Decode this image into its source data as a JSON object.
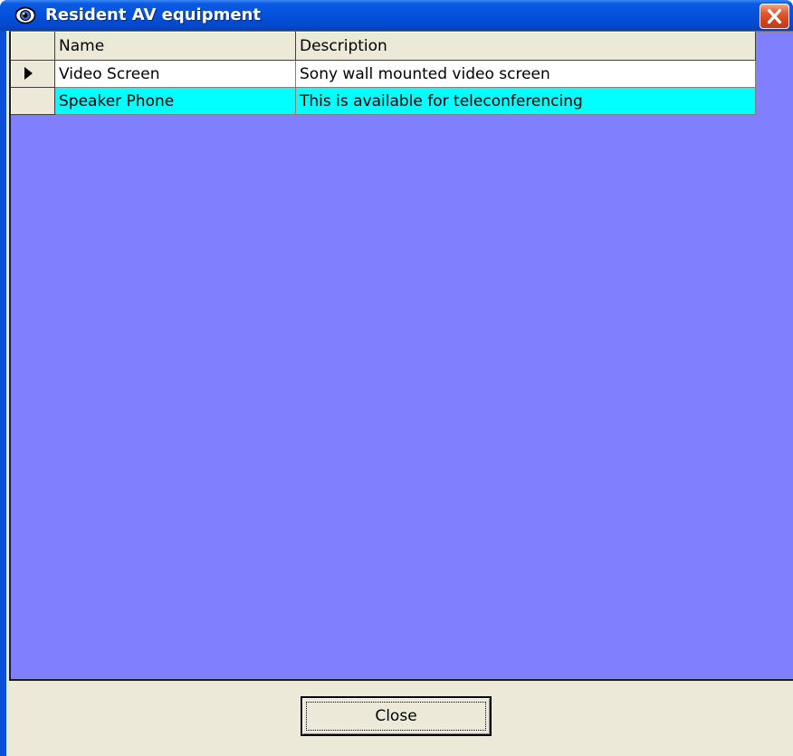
{
  "window": {
    "title": "Resident AV equipment",
    "title_icon": "eye-icon",
    "close_icon": "close-icon"
  },
  "grid": {
    "columns": [
      "Name",
      "Description"
    ],
    "rows": [
      {
        "name": "Video Screen",
        "description": "Sony wall mounted video screen",
        "current": true
      },
      {
        "name": "Speaker Phone",
        "description": "This is available for teleconferencing",
        "current": false
      }
    ],
    "row_colors": [
      "#ffffff",
      "#00ffff"
    ],
    "background_color": "#8080ff"
  },
  "footer": {
    "close_label": "Close"
  }
}
